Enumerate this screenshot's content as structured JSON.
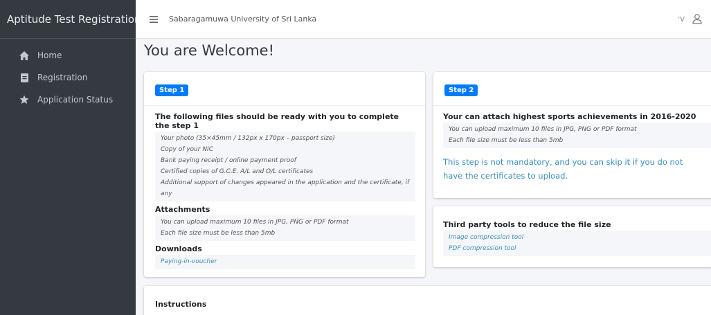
{
  "sidebar": {
    "brand": "Aptitude Test Registration",
    "items": [
      {
        "label": "Home",
        "icon": "home-icon"
      },
      {
        "label": "Registration",
        "icon": "document-icon"
      },
      {
        "label": "Application Status",
        "icon": "star-icon"
      }
    ]
  },
  "topbar": {
    "title": "Sabaragamuwa University of Sri Lanka",
    "right_text": "'V"
  },
  "page_title": "You are Welcome!",
  "step1": {
    "badge": "Step 1",
    "files_heading": "The following files should be ready with you to complete the step 1",
    "files": [
      "Your photo (35×45mm / 132px x 170px – passport size)",
      "Copy of your NIC",
      "Bank paying receipt / online payment proof",
      "Certified copies of G.C.E. A/L and O/L certificates",
      "Additional support of changes appeared in the application and the certificate, if any"
    ],
    "attachments_heading": "Attachments",
    "attachments": [
      "You can upload maximum 10 files in JPG, PNG or PDF format",
      "Each file size must be less than 5mb"
    ],
    "downloads_heading": "Downloads",
    "downloads": [
      "Paying-in-voucher"
    ]
  },
  "step2": {
    "badge": "Step 2",
    "heading": "Your can attach highest sports achievements in 2016-2020",
    "lines": [
      "You can upload maximum 10 files in JPG, PNG or PDF format",
      "Each file size must be less than 5mb"
    ],
    "note": "This step is not mandatory, and you can skip it if you do not have the certificates to upload."
  },
  "tools": {
    "heading": "Third party tools to reduce the file size",
    "links": [
      "Image compression tool",
      "PDF compression tool"
    ]
  },
  "instructions": {
    "heading": "Instructions"
  },
  "colors": {
    "sidebar": "#343a40",
    "accent": "#007bff",
    "link": "#3c8dbc"
  }
}
